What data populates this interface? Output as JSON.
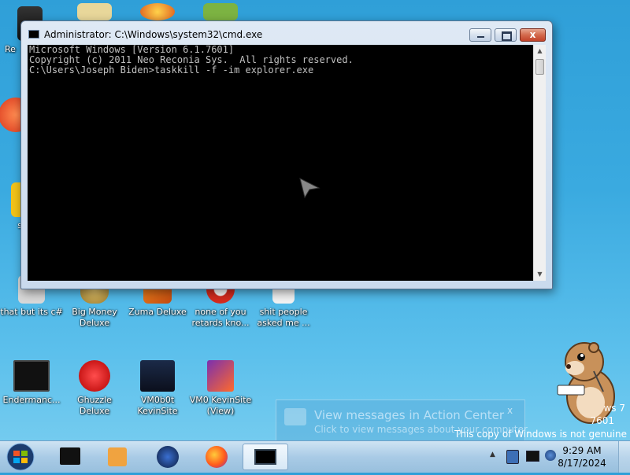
{
  "desktop": {
    "icons": [
      {
        "label": "Re"
      },
      {
        "label": "som re"
      },
      {
        "label": "that but its c#"
      },
      {
        "label": "Big Money Deluxe"
      },
      {
        "label": "Zuma Deluxe"
      },
      {
        "label": "none of you retards kno..."
      },
      {
        "label": "shit people asked me ..."
      },
      {
        "label": "Endermanc..."
      },
      {
        "label": "Ghuzzle Deluxe"
      },
      {
        "label": "VM0b0t KevinSite"
      },
      {
        "label": "VM0 KevinSite (View)"
      }
    ]
  },
  "cmd": {
    "title": "Administrator: C:\\Windows\\system32\\cmd.exe",
    "lines": [
      "Microsoft Windows [Version 6.1.7601]",
      "Copyright (c) 2011 Neo Reconia Sys.  All rights reserved.",
      "",
      "C:\\Users\\Joseph Biden>taskkill -f -im explorer.exe"
    ],
    "close_glyph": "x"
  },
  "notification": {
    "title": "View messages in Action Center",
    "subtitle": "Click to view messages about your computer.",
    "close_glyph": "x"
  },
  "watermark": {
    "line1": "ws 7",
    "line2": "7601",
    "line3": "This copy of Windows is not genuine"
  },
  "taskbar": {
    "clock_time": "9:29 AM",
    "clock_date": "8/17/2024",
    "tray_expand": "▲"
  },
  "colors": {
    "console_bg": "#000000",
    "console_text": "#c0c0c0",
    "desktop_bg": "#3aaae0"
  }
}
